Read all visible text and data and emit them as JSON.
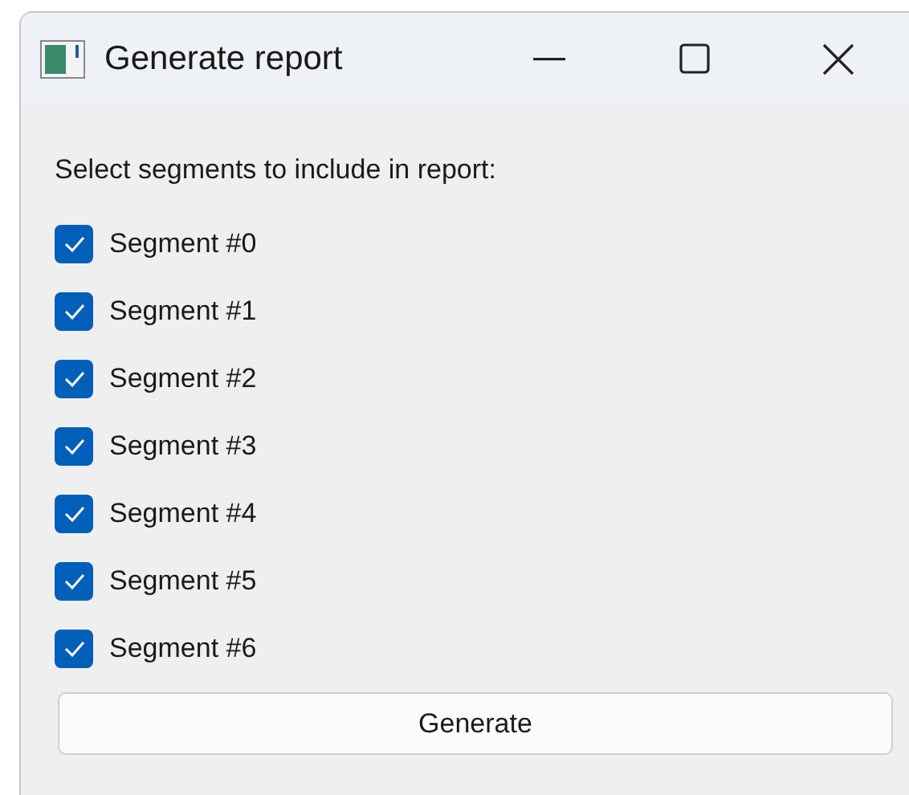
{
  "window": {
    "title": "Generate report"
  },
  "prompt": "Select segments to include in report:",
  "segments": [
    {
      "label": "Segment #0",
      "checked": true
    },
    {
      "label": "Segment #1",
      "checked": true
    },
    {
      "label": "Segment #2",
      "checked": true
    },
    {
      "label": "Segment #3",
      "checked": true
    },
    {
      "label": "Segment #4",
      "checked": true
    },
    {
      "label": "Segment #5",
      "checked": true
    },
    {
      "label": "Segment #6",
      "checked": true
    }
  ],
  "button": "Generate"
}
